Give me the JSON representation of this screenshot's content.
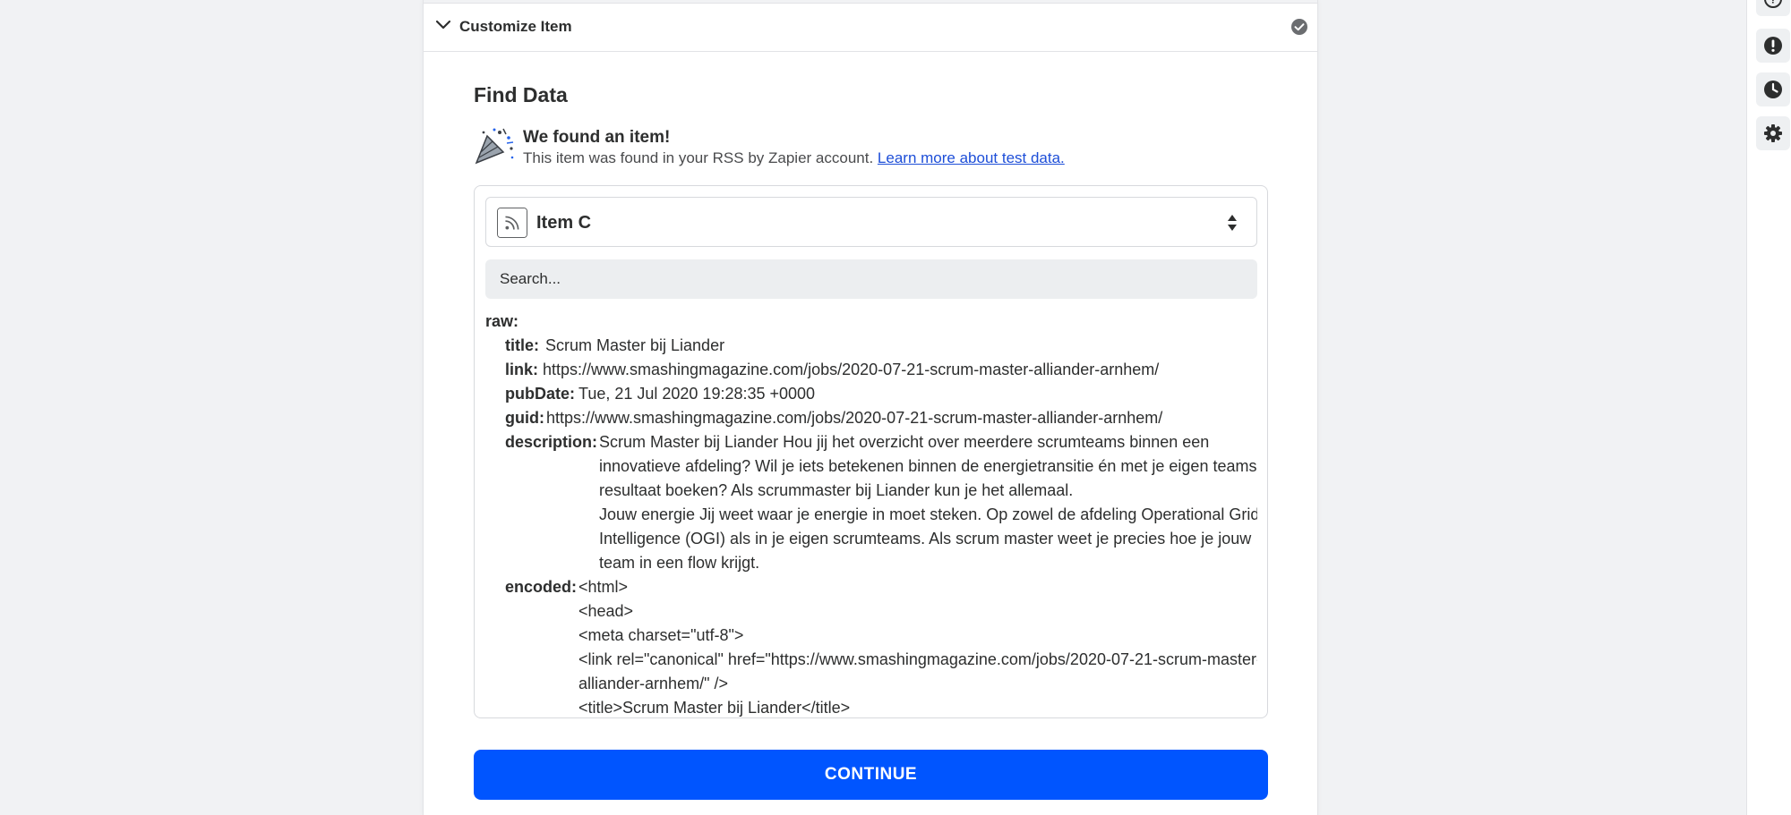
{
  "section": {
    "title": "Customize Item"
  },
  "find_data": {
    "title": "Find Data",
    "found_heading": "We found an item!",
    "found_text": "This item was found in your RSS by Zapier account.",
    "learn_more": "Learn more about test data."
  },
  "item_select": {
    "selected": "Item C"
  },
  "search": {
    "placeholder": "Search..."
  },
  "raw": {
    "label": "raw:",
    "title_key": "title:",
    "title_val": "Scrum Master bij Liander",
    "link_key": "link:",
    "link_val": "https://www.smashingmagazine.com/jobs/2020-07-21-scrum-master-alliander-arnhem/",
    "pubdate_key": "pubDate:",
    "pubdate_val": "Tue, 21 Jul 2020 19:28:35 +0000",
    "guid_key": "guid:",
    "guid_val": "https://www.smashingmagazine.com/jobs/2020-07-21-scrum-master-alliander-arnhem/",
    "description_key": "description:",
    "description_lines": [
      "Scrum Master bij Liander Hou jij het overzicht over meerdere scrumteams binnen een",
      "innovatieve afdeling? Wil je iets betekenen binnen de energietransitie én met je eigen teams",
      "resultaat boeken? Als scrummaster bij Liander kun je het allemaal.",
      "Jouw energie Jij weet waar je energie in moet steken. Op zowel de afdeling Operational Grid",
      "Intelligence (OGI) als in je eigen scrumteams. Als scrum master weet je precies hoe je jouw",
      "team in een flow krijgt."
    ],
    "encoded_key": "encoded:",
    "encoded_lines": [
      "<html>",
      "<head>",
      "<meta charset=\"utf-8\">",
      "<link rel=\"canonical\" href=\"https://www.smashingmagazine.com/jobs/2020-07-21-scrum-master-",
      "alliander-arnhem/\" />",
      "<title>Scrum Master bij Liander</title>"
    ]
  },
  "continue_label": "CONTINUE",
  "icons": {
    "rail": [
      "help-icon",
      "alert-icon",
      "history-icon",
      "settings-icon"
    ]
  },
  "colors": {
    "primary": "#0055ff",
    "link": "#1d4ed8",
    "text": "#2d2e2e"
  }
}
